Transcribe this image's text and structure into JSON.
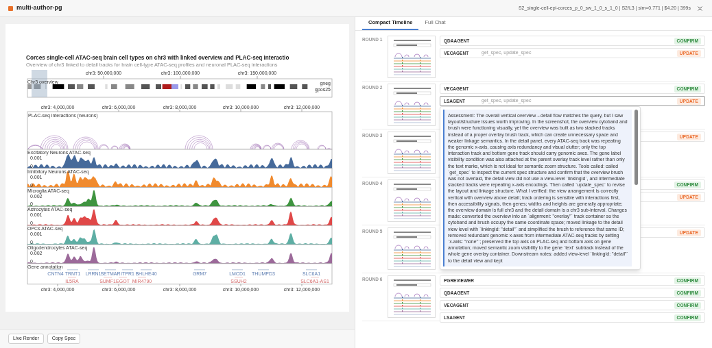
{
  "header": {
    "title": "multi-author-pg",
    "meta": "S2_single-cell-epi-corces_p_0_sw_1_0_s_1_0 | S2/L3 | sim=0.771 | $4.20 | 399s"
  },
  "preview": {
    "title": "Corces single-cell ATAC-seq brain cell types on chr3 with linked overview and PLAC-seq interactio",
    "subtitle": "Overview of chr3 linked to detail tracks for brain cell-type ATAC-seq profiles and neuronal PLAC-seq interactions",
    "overview": {
      "label": "Chr3 overview",
      "ticks": [
        "chr3: 50,000,000",
        "chr3: 100,000,000",
        "chr3: 150,000,000"
      ],
      "legend": [
        "gneg",
        "gpos25"
      ]
    },
    "top_ticks": [
      "chr3: 4,000,000",
      "chr3: 6,000,000",
      "chr3: 8,000,000",
      "chr3: 10,000,000",
      "chr3: 12,000,000"
    ],
    "interaction_track": {
      "label": "PLAC-seq interactions (neurons)"
    },
    "tracks": [
      {
        "label": "Excitatory Neurons ATAC-seq",
        "color": "#466a9a",
        "ticks": [
          "0.001",
          "0"
        ]
      },
      {
        "label": "Inhibitory Neurons ATAC-seq",
        "color": "#f08a2e",
        "ticks": [
          "0.001",
          "0"
        ]
      },
      {
        "label": "Microglia ATAC-seq",
        "color": "#3f9440",
        "ticks": [
          "0.002",
          "0"
        ]
      },
      {
        "label": "Astrocytes ATAC-seq",
        "color": "#e04848",
        "ticks": [
          "0.001",
          "0"
        ]
      },
      {
        "label": "OPCs ATAC-seq",
        "color": "#5eaea4",
        "ticks": [
          "0.001",
          "0"
        ]
      },
      {
        "label": "Oligodendrocytes ATAC-seq",
        "color": "#9c6a9a",
        "ticks": [
          "0.002",
          "0"
        ]
      }
    ],
    "genes": {
      "label": "Gene annotation",
      "plus": [
        "CNTN4",
        "TRNT1",
        "LRRN1",
        "SETMAR",
        "ITPR1",
        "BHLHE40",
        "GRM7",
        "LMCD1",
        "THUMPD3",
        "SLC6A1"
      ],
      "minus": [
        "IL5RA",
        "SUMF1",
        "EGOT",
        "MIR4790",
        "SSUH2",
        "SLC6A1-AS1"
      ]
    },
    "bottom_ticks": [
      "chr3: 4,000,000",
      "chr3: 6,000,000",
      "chr3: 8,000,000",
      "chr3: 10,000,000",
      "chr3: 12,000,000"
    ]
  },
  "buttons": [
    "Live Render",
    "Copy Spec"
  ],
  "tabs": [
    {
      "label": "Compact Timeline",
      "selected": true
    },
    {
      "label": "Full Chat",
      "selected": false
    }
  ],
  "rounds": [
    {
      "label": "ROUND 1",
      "rows": [
        {
          "agent": "QDAAGENT",
          "badge": "CONFIRM",
          "kind": "confirm",
          "selected": false
        },
        {
          "agent": "VECAGENT",
          "tools": "get_spec, update_spec",
          "badge": "UPDATE",
          "kind": "update",
          "selected": false
        }
      ]
    },
    {
      "label": "ROUND 2",
      "rows": [
        {
          "agent": "VECAGENT",
          "badge": "CONFIRM",
          "kind": "confirm",
          "selected": false
        },
        {
          "agent": "LSAGENT",
          "tools": "get_spec, update_spec",
          "badge": "UPDATE",
          "kind": "update",
          "selected": true
        }
      ]
    },
    {
      "label": "ROUND 3",
      "rows": [
        {
          "badge": "UPDATE",
          "kind": "update",
          "selected": false
        }
      ]
    },
    {
      "label": "ROUND 4",
      "rows": [
        {
          "badge": "CONFIRM",
          "kind": "confirm",
          "selected": false
        },
        {
          "badge": "UPDATE",
          "kind": "update",
          "selected": false
        }
      ]
    },
    {
      "label": "ROUND 5",
      "rows": [
        {
          "badge": "UPDATE",
          "kind": "update",
          "selected": false
        }
      ]
    },
    {
      "label": "ROUND 6",
      "rows": [
        {
          "agent": "PGREVIEWER",
          "badge": "CONFIRM",
          "kind": "confirm",
          "selected": false
        },
        {
          "agent": "QDAAGENT",
          "badge": "CONFIRM",
          "kind": "confirm",
          "selected": false
        },
        {
          "agent": "VECAGENT",
          "badge": "CONFIRM",
          "kind": "confirm",
          "selected": false
        },
        {
          "agent": "LSAGENT",
          "badge": "CONFIRM",
          "kind": "confirm",
          "selected": false
        }
      ]
    }
  ],
  "popover": {
    "text": "Assessment: The overall vertical overview→detail flow matches the query, but I saw layout/structure issues worth improving. In the screenshot, the overview cytoband and brush were functioning visually, yet the overview was built as two stacked tracks instead of a proper overlay brush track, which can create unnecessary space and weaker linkage semantics. In the detail panel, every ATAC-seq track was repeating the genomic x-axis, causing axis redundancy and visual clutter; only the top interaction track and bottom gene track should carry genomic axes. The gene label visibility condition was also attached at the parent overlay track level rather than only the text marks, which is not ideal for semantic zoom structure. Tools called: called `get_spec` to inspect the current spec structure and confirm that the overview brush was not overlaid, the detail view did not use a view-level `linkingId`, and intermediate stacked tracks were repeating x-axis encodings. Then called `update_spec` to revise the layout and linkage structure. What I verified: the view arrangement is correctly vertical with overview above detail; track ordering is sensible with interactions first, then accessibility signals, then genes; widths and heights are generally appropriate; the overview domain is full chr3 and the detail domain is a chr3 sub-interval. Changes made: converted the overview into an `alignment: \"overlay\"` track container so the cytoband and brush occupy the same coordinate space; moved linkage to the detail view level with `linkingId: \"detail\"` and simplified the brush to reference that same ID; removed redundant genomic x-axes from intermediate ATAC-seq tracks by setting `x.axis: \"none\"`; preserved the top axis on PLAC-seq and bottom axis on gene annotation; moved semantic zoom visibility to the gene `text` subtrack instead of the whole gene overlay container. Downstream notes: added view-level `linkingId: \"detail\"` to the detail view and kept"
  }
}
